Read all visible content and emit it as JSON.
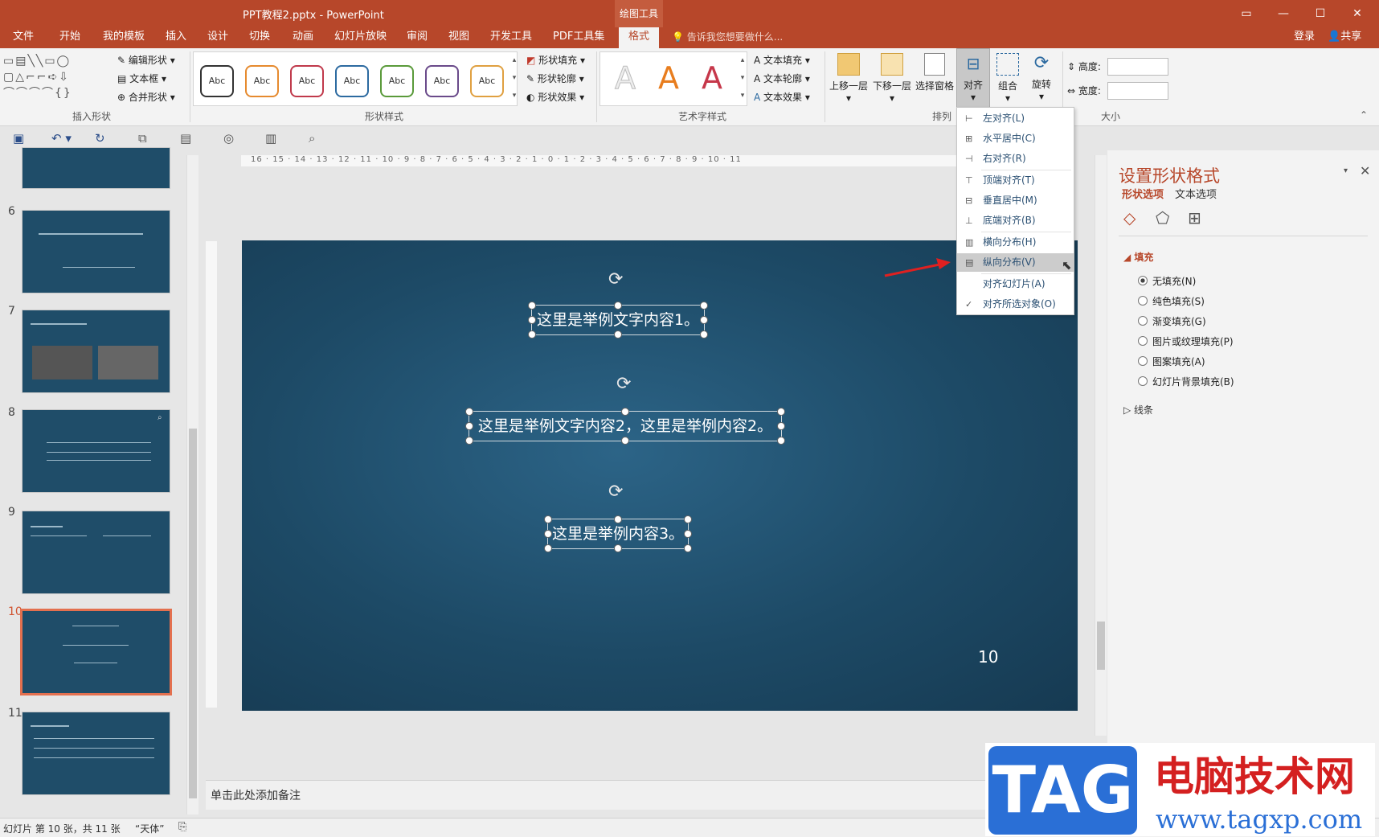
{
  "window": {
    "title": "PPT教程2.pptx - PowerPoint",
    "context_group": "绘图工具",
    "controls": [
      "▭",
      "🗗",
      "—",
      "☐",
      "✕"
    ]
  },
  "tabs": [
    "文件",
    "开始",
    "我的模板",
    "插入",
    "设计",
    "切换",
    "动画",
    "幻灯片放映",
    "审阅",
    "视图",
    "开发工具",
    "PDF工具集",
    "格式"
  ],
  "active_tab": "格式",
  "tell_me": "告诉我您想要做什么...",
  "account": {
    "login": "登录",
    "share": "共享"
  },
  "ribbon": {
    "insert_shapes": {
      "label": "插入形状",
      "edit_shape": "编辑形状",
      "text_box": "文本框",
      "merge_shapes": "合并形状"
    },
    "shape_styles": {
      "label": "形状样式",
      "sample_text": "Abc",
      "colors": [
        "#222222",
        "#e68a2e",
        "#c0394b",
        "#2c6aa0",
        "#5a9a3a",
        "#6a4a8a",
        "#e0a040"
      ],
      "fill": "形状填充",
      "outline": "形状轮廓",
      "effects": "形状效果"
    },
    "wordart": {
      "label": "艺术字样式",
      "fill": "文本填充",
      "outline": "文本轮廓",
      "effects": "文本效果",
      "letter": "A"
    },
    "arrange": {
      "label": "排列",
      "bring_forward": "上移一层",
      "send_backward": "下移一层",
      "selection_pane": "选择窗格",
      "align": "对齐",
      "group": "组合",
      "rotate": "旋转"
    },
    "size": {
      "label": "大小",
      "height": "高度:",
      "width": "宽度:"
    }
  },
  "align_menu": [
    {
      "label": "左对齐(L)",
      "icon": "⊢",
      "checked": false
    },
    {
      "label": "水平居中(C)",
      "icon": "⊞",
      "checked": false
    },
    {
      "label": "右对齐(R)",
      "icon": "⊣",
      "checked": false
    },
    {
      "label": "顶端对齐(T)",
      "icon": "⊤",
      "checked": false
    },
    {
      "label": "垂直居中(M)",
      "icon": "⊟",
      "checked": false
    },
    {
      "label": "底端对齐(B)",
      "icon": "⊥",
      "checked": false
    },
    {
      "label": "横向分布(H)",
      "icon": "▥",
      "checked": false
    },
    {
      "label": "纵向分布(V)",
      "icon": "▤",
      "checked": false,
      "hover": true
    },
    {
      "label": "对齐幻灯片(A)",
      "icon": "",
      "checked": false
    },
    {
      "label": "对齐所选对象(O)",
      "icon": "✓",
      "checked": true
    }
  ],
  "thumbnails": {
    "numbers": [
      "6",
      "7",
      "8",
      "9",
      "10",
      "11"
    ],
    "selected": "10"
  },
  "ruler_numbers": "16 · 15 · 14 · 13 · 12 · 11 · 10 · 9 · 8 · 7 · 6 · 5 · 4 · 3 · 2 · 1 · 0 · 1 · 2 · 3 · 4 · 5 · 6 · 7 · 8 · 9 · 10 · 11",
  "slide": {
    "text1": "这里是举例文字内容1。",
    "text2": "这里是举例文字内容2，这里是举例内容2。",
    "text3": "这里是举例内容3。",
    "number": "10"
  },
  "notes_placeholder": "单击此处添加备注",
  "format_pane": {
    "title": "设置形状格式",
    "tab_shape": "形状选项",
    "tab_text": "文本选项",
    "fill_header": "填充",
    "fill_options": [
      "无填充(N)",
      "纯色填充(S)",
      "渐变填充(G)",
      "图片或纹理填充(P)",
      "图案填充(A)",
      "幻灯片背景填充(B)"
    ],
    "line_header": "线条"
  },
  "status": {
    "slide_info": "幻灯片 第 10 张，共 11 张",
    "theme": "“天体”"
  },
  "watermark": {
    "tag": "TAG",
    "cn": "电脑技术网",
    "url": "www.tagxp.com"
  }
}
